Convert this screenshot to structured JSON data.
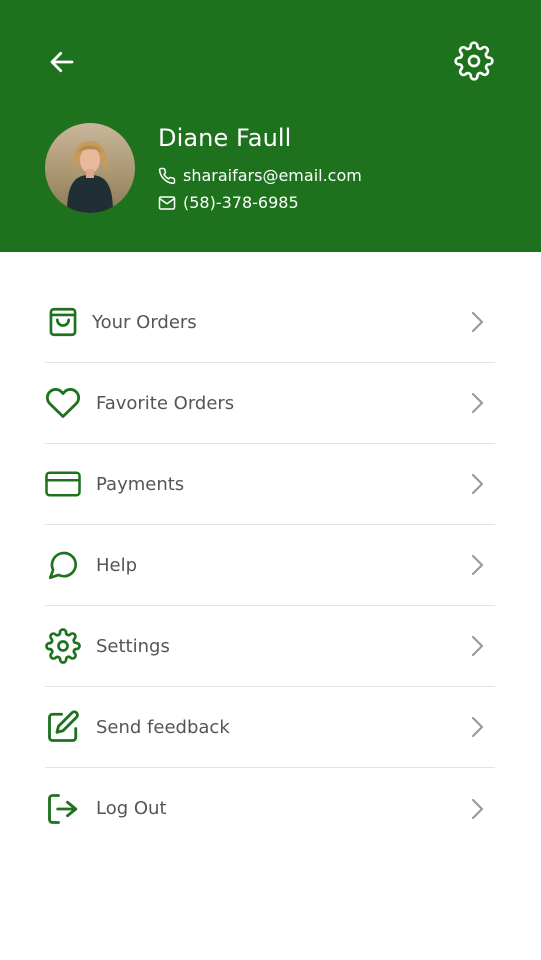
{
  "colors": {
    "brand_green": "#1e721e",
    "text_gray": "#555555",
    "chevron_gray": "#9a9a9a",
    "divider": "#e4e4e4"
  },
  "header": {
    "back_icon": "arrow-left-icon",
    "settings_icon": "gear-icon"
  },
  "profile": {
    "name": "Diane Faull",
    "email": "sharaifars@email.com",
    "phone": "(58)-378-6985",
    "email_icon": "phone-icon",
    "phone_icon": "mail-icon"
  },
  "menu": [
    {
      "label": "Your Orders",
      "icon": "shopping-bag-icon"
    },
    {
      "label": "Favorite Orders",
      "icon": "heart-icon"
    },
    {
      "label": "Payments",
      "icon": "credit-card-icon"
    },
    {
      "label": "Help",
      "icon": "chat-bubble-icon"
    },
    {
      "label": "Settings",
      "icon": "gear-icon"
    },
    {
      "label": "Send feedback",
      "icon": "edit-icon"
    },
    {
      "label": "Log Out",
      "icon": "logout-icon"
    }
  ]
}
